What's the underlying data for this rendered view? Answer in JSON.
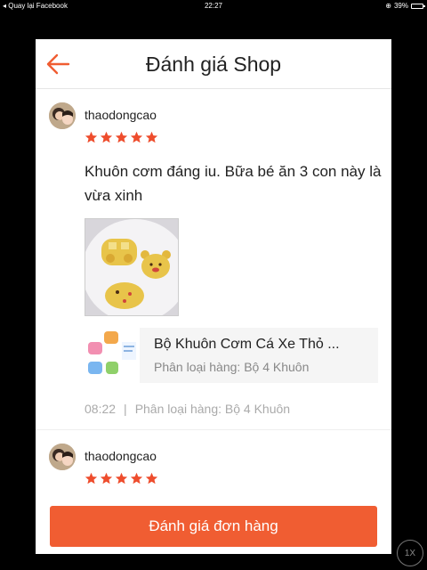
{
  "status_bar": {
    "back_app": "◂ Quay lại Facebook",
    "time": "22:27",
    "battery": "39%",
    "battery_level": 0.39
  },
  "header": {
    "title": "Đánh giá Shop",
    "back_icon": "arrow-left-icon"
  },
  "reviews": [
    {
      "username": "thaodongcao",
      "rating": 5,
      "comment": "Khuôn cơm đáng iu. Bữa bé ăn 3 con này là vừa xinh",
      "product": {
        "name": "Bộ Khuôn Cơm Cá Xe Thỏ ...",
        "variant": "Phân loại hàng: Bộ 4 Khuôn"
      },
      "time": "08:22",
      "variant_meta": "Phân loại hàng:  Bộ 4 Khuôn"
    },
    {
      "username": "thaodongcao",
      "rating": 5
    }
  ],
  "footer": {
    "button_label": "Đánh giá đơn hàng"
  },
  "zoom_indicator": "1X",
  "colors": {
    "accent": "#f05d32",
    "star": "#ee4d2d"
  }
}
